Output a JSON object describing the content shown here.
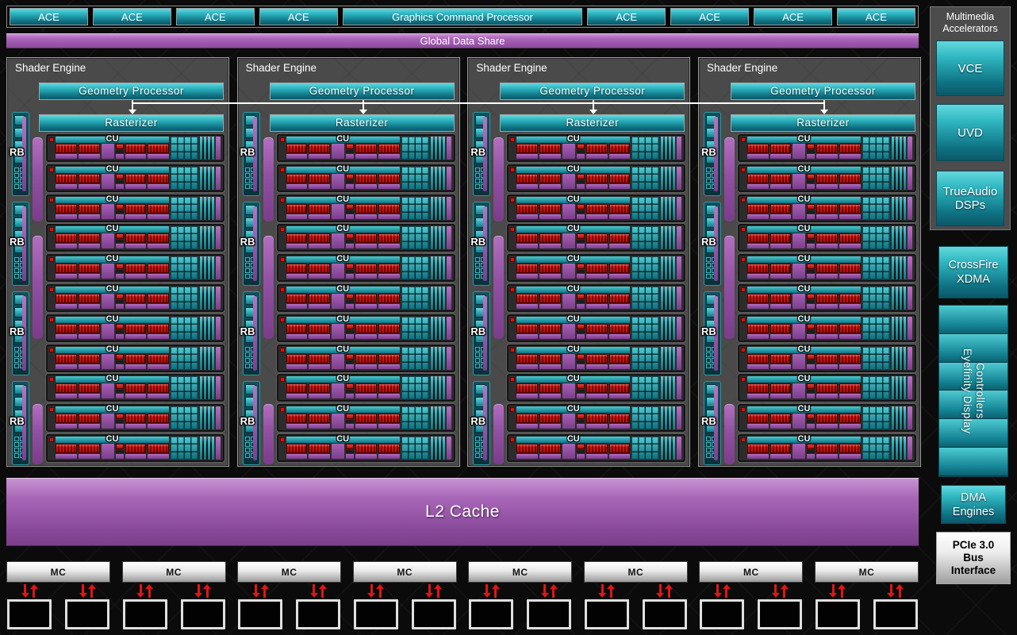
{
  "colors": {
    "teal_light": "#63d8dd",
    "teal_dark": "#0a5868",
    "purple": "#9c55ad",
    "red": "#e01510",
    "silver": "#e9e9e9",
    "panel_gray": "#4a4a4a",
    "background": "#0b0b0b"
  },
  "top": {
    "ace_label": "ACE",
    "ace_count_left": 4,
    "ace_count_right": 4,
    "gcp_label": "Graphics Command Processor"
  },
  "global_data_share": "Global Data Share",
  "shader_engines": {
    "count": 4,
    "title": "Shader Engine",
    "geometry_label": "Geometry Processor",
    "rasterizer_label": "Rasterizer",
    "rb_label": "RB",
    "rb_count": 4,
    "cu_label": "CU",
    "cu_count": 11
  },
  "l2_cache": "L2 Cache",
  "memory": {
    "mc_label": "MC",
    "mc_count": 8,
    "chips_per_mc": 2
  },
  "sidebar": {
    "multimedia": {
      "title": "Multimedia Accelerators",
      "items": [
        "VCE",
        "UVD",
        "TrueAudio\nDSPs"
      ]
    },
    "crossfire": "CrossFire\nXDMA",
    "eyefinity": "Eyefinity Display\nControllers",
    "eyefinity_segments": 6,
    "dma": "DMA\nEngines",
    "pcie": "PCIe 3.0\nBus\nInterface"
  }
}
